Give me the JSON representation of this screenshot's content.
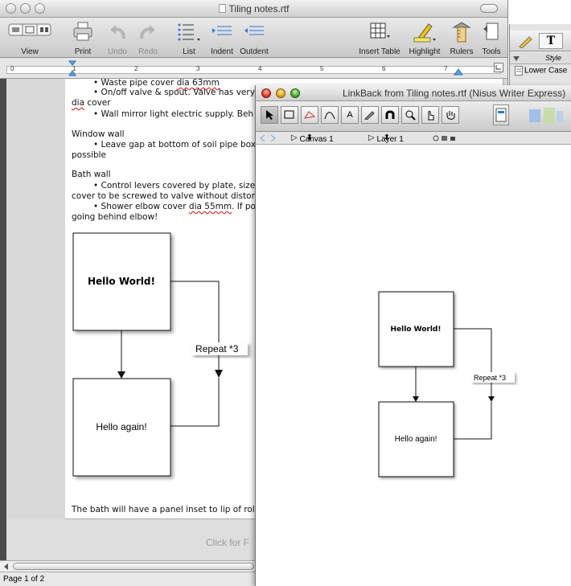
{
  "main_window": {
    "title": "Tiling notes.rtf",
    "toolbar": {
      "view": "View",
      "print": "Print",
      "undo": "Undo",
      "redo": "Redo",
      "list": "List",
      "indent": "Indent",
      "outdent": "Outdent",
      "insert_table": "Insert Table",
      "highlight": "Highlight",
      "rulers": "Rulers",
      "tools": "Tools"
    },
    "ruler_numbers": [
      "0",
      "1",
      "2",
      "3",
      "4",
      "5",
      "6",
      "7"
    ],
    "document": {
      "line1_prefix": "•   Waste pipe cover ",
      "line1_err": "dia 63mm",
      "line2": "•   On/off valve & spout.  Valve has very",
      "line3_err": "dia",
      "line3_rest": " cover",
      "line4": "•   Wall mirror light electric supply.  Beh",
      "heading_window": "Window wall",
      "line6": "•   Leave gap at bottom of soil pipe box",
      "line7": "possible",
      "heading_bath": "Bath wall",
      "line9": "•   Control levers covered by plate, size",
      "line10": "cover to be screwed to valve without distorti",
      "line11_prefix": "•   Shower elbow cover ",
      "line11_err": "dia 55mm",
      "line11_rest": ".  If po",
      "line12": "going behind elbow!",
      "footer_line": "The bath will have a panel inset to lip of roll",
      "click_hint": "Click for F"
    },
    "diagram": {
      "box1": "Hello World!",
      "box2": "Hello again!",
      "edge_label": "Repeat *3"
    },
    "status": "Page 1 of 2"
  },
  "style_drawer": {
    "header": "Style",
    "item": "Lower Case"
  },
  "linkback_window": {
    "title": "LinkBack from Tiling notes.rtf (Nisus Writer Express)",
    "canvas_selector": "Canvas 1",
    "layer_selector": "Layer 1",
    "diagram": {
      "box1": "Hello World!",
      "box2": "Hello again!",
      "edge_label": "Repeat *3"
    }
  }
}
